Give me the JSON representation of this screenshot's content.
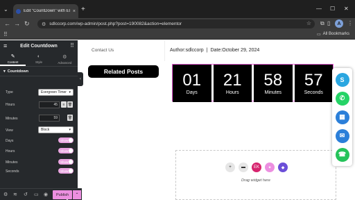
{
  "browser": {
    "tab_title": "Edit \"CountDown\" with Elementor",
    "url": "sdlccorp.com/wp-admin/post.php?post=190082&action=elementor",
    "all_bookmarks": "All Bookmarks",
    "profile_initial": "A"
  },
  "panel": {
    "title": "Edit Countdown",
    "tabs": [
      {
        "label": "Content",
        "icon": "pencil-icon"
      },
      {
        "label": "Style",
        "icon": "half-circle-icon"
      },
      {
        "label": "Advanced",
        "icon": "gear-icon"
      }
    ],
    "section": "Countdown",
    "type_label": "Type",
    "type_value": "Evergreen Timer",
    "hours_label": "Hours",
    "hours_value": "45",
    "minutes_label": "Minutes",
    "minutes_value": "59",
    "view_label": "View",
    "view_value": "Block",
    "toggles": [
      {
        "label": "Days",
        "state": "Show"
      },
      {
        "label": "Hours",
        "state": "Show"
      },
      {
        "label": "Minutes",
        "state": "Show"
      },
      {
        "label": "Seconds",
        "state": "Show"
      }
    ],
    "publish_label": "Publish"
  },
  "preview": {
    "contact": "Contact Us",
    "related_posts": "Related Posts",
    "author": "Author:sdlccorp",
    "separator": "|",
    "date": "Date:October 29, 2024",
    "countdown": [
      {
        "value": "01",
        "label": "Days"
      },
      {
        "value": "21",
        "label": "Hours"
      },
      {
        "value": "58",
        "label": "Minutes"
      },
      {
        "value": "57",
        "label": "Seconds"
      }
    ],
    "drop_text": "Drag widget here"
  },
  "colors": {
    "accent": "#ec8fe0",
    "countdown_border": "#ec5fd9",
    "skype": "#2aa6e0",
    "whatsapp": "#25d366",
    "calendar": "#2b7fd9",
    "email": "#2b7fd9",
    "phone": "#25c35a"
  }
}
